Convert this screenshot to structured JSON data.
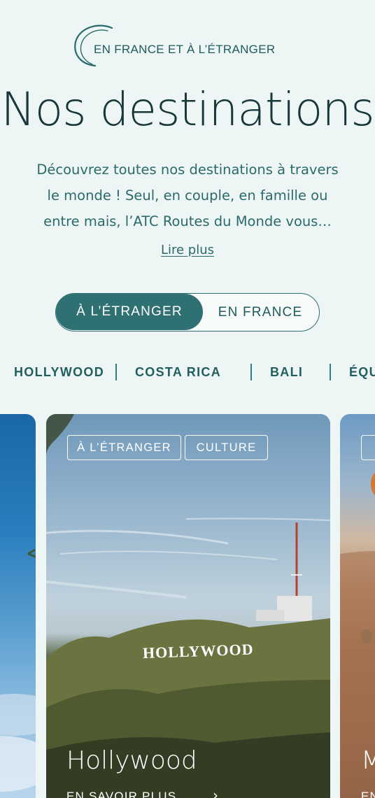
{
  "header": {
    "eyebrow": "EN FRANCE ET À L’ÉTRANGER",
    "title": "Nos destinations",
    "intro_line1": "Découvrez toutes nos destinations à travers",
    "intro_line2": "le monde ! Seul, en couple, en famille ou",
    "intro_line3": "entre mais, l’ATC Routes du Monde vous…",
    "read_more": "Lire plus"
  },
  "toggle": {
    "active": "À L’ÉTRANGER",
    "inactive": "EN FRANCE"
  },
  "destinations_nav": [
    "HOLLYWOOD",
    "COSTA RICA",
    "BALI",
    "ÉQU"
  ],
  "cards": {
    "main": {
      "tags": [
        "À L’ÉTRANGER",
        "CULTURE"
      ],
      "sign_text": "HOLLYWOOD",
      "title": "Hollywood",
      "cta": "EN SAVOIR PLUS",
      "cta_icon": "arrow-right-icon"
    },
    "right": {
      "title_fragment": "M",
      "cta_fragment": "EN"
    }
  },
  "colors": {
    "background": "#eef6f5",
    "primary": "#2f7073",
    "text": "#1d4d4f"
  }
}
